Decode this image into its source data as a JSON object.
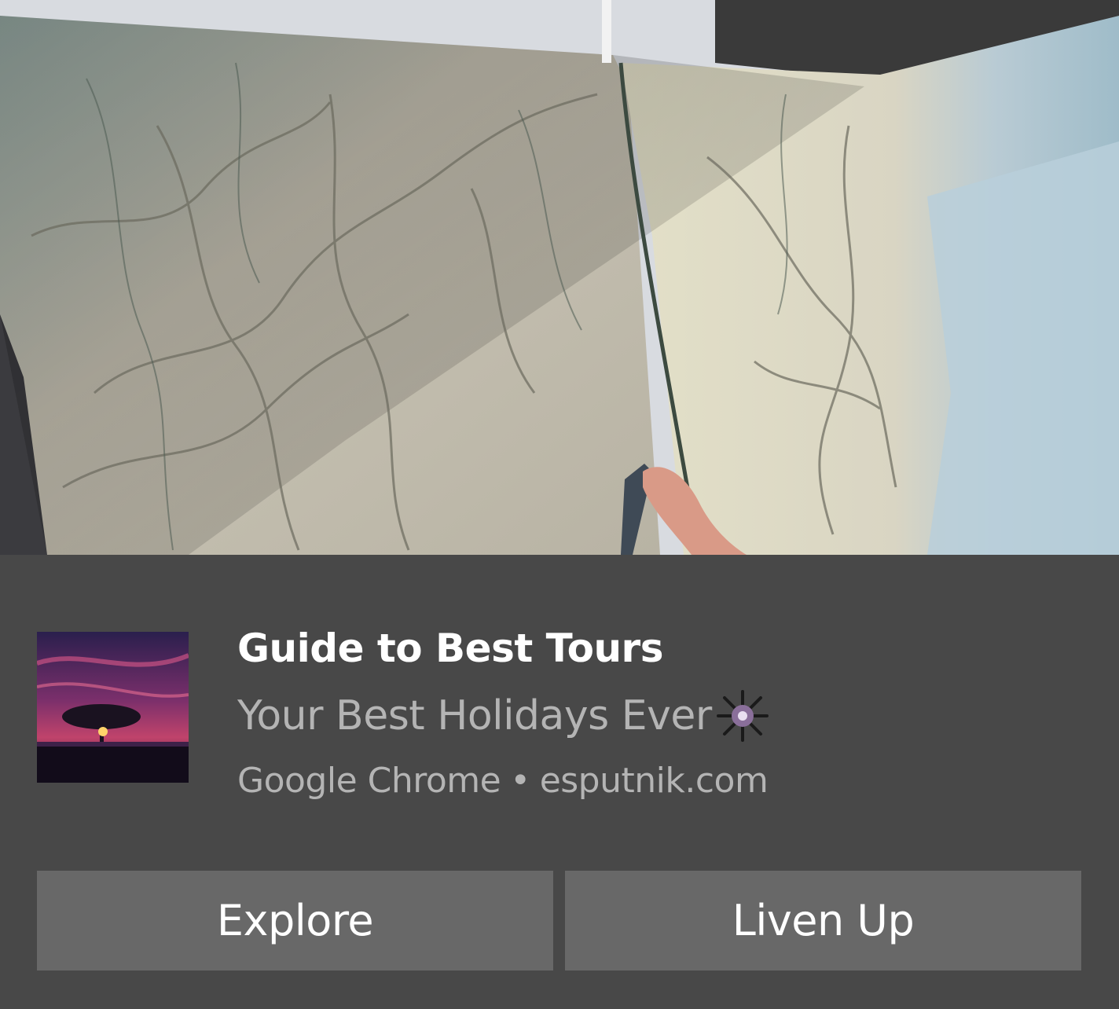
{
  "notification": {
    "title": "Guide to Best Tours",
    "subtitle": "Your Best Holidays Ever",
    "source_app": "Google Chrome",
    "separator": "•",
    "domain": "esputnik.com",
    "hero_image": "road-map-photo",
    "app_logo_image": "tree-sunset-logo",
    "subtitle_icon": "sparkle-icon"
  },
  "actions": {
    "explore_label": "Explore",
    "liven_up_label": "Liven Up"
  },
  "colors": {
    "background": "#484848",
    "button_background": "#686868",
    "title_text": "#ffffff",
    "secondary_text": "#b4b4b4"
  }
}
